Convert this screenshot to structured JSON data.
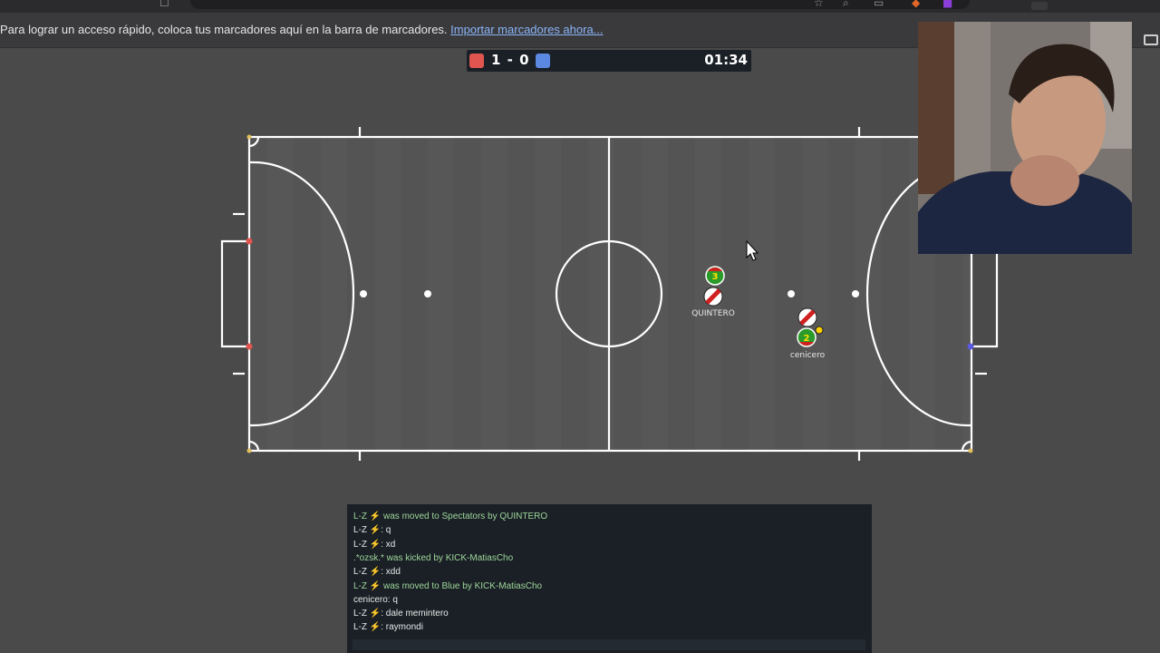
{
  "bookmarks_bar": {
    "message": "Para lograr un acceso rápido, coloca tus marcadores aquí en la barra de marcadores.",
    "link": "Importar marcadores ahora..."
  },
  "scoreboard": {
    "red_color": "#e05550",
    "blue_color": "#5b88e0",
    "red_score": "1",
    "separator": "-",
    "blue_score": "0",
    "clock": "01:34"
  },
  "players": [
    {
      "name": "QUINTERO",
      "number": "3",
      "avatar_label": ""
    },
    {
      "name": "cenicero",
      "number": "2",
      "avatar_label": ""
    }
  ],
  "chat": {
    "messages": [
      {
        "text": "L-Z ⚡ was moved to Spectators by QUINTERO",
        "type": "notice"
      },
      {
        "text": "L-Z ⚡: q",
        "type": "msg"
      },
      {
        "text": "L-Z ⚡: xd",
        "type": "msg"
      },
      {
        "text": ".*ozsk.* was kicked by KICK-MatiasCho",
        "type": "notice"
      },
      {
        "text": "L-Z ⚡: xdd",
        "type": "msg"
      },
      {
        "text": "L-Z ⚡ was moved to Blue by KICK-MatiasCho",
        "type": "notice"
      },
      {
        "text": "cenicero: q",
        "type": "msg"
      },
      {
        "text": "L-Z ⚡: dale memintero",
        "type": "msg"
      },
      {
        "text": "L-Z ⚡: raymondi",
        "type": "msg"
      }
    ]
  },
  "icons": [
    "folder-icon",
    "mouse-cursor-icon",
    "star-icon",
    "search-icon",
    "extension-icon"
  ]
}
